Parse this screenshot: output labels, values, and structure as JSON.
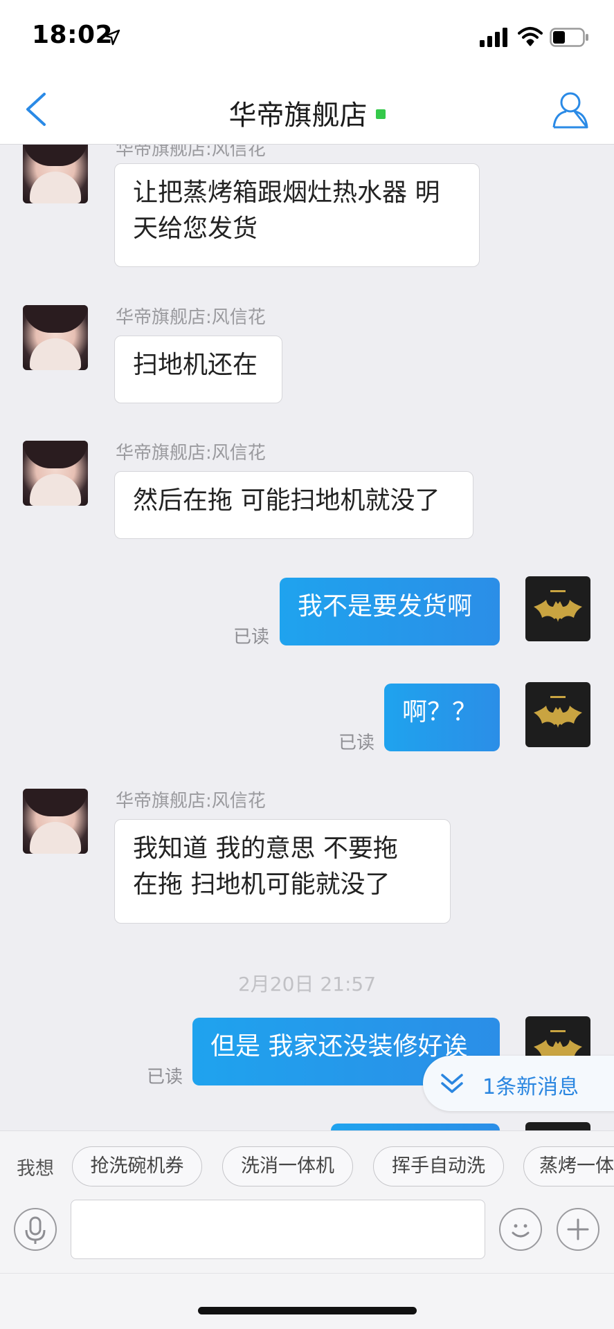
{
  "status_bar": {
    "time": "18:02"
  },
  "nav": {
    "title": "华帝旗舰店"
  },
  "messages": {
    "m1_sender": "华帝旗舰店:风信花",
    "m1_line1": "让把蒸烤箱跟烟灶热水器  明",
    "m1_line2": "天给您发货",
    "m2_sender": "华帝旗舰店:风信花",
    "m2_text": "扫地机还在",
    "m3_sender": "华帝旗舰店:风信花",
    "m3_text": "然后在拖 可能扫地机就没了",
    "m4_text": "我不是要发货啊",
    "m4_status": "已读",
    "m5_text": "啊？？",
    "m5_status": "已读",
    "m6_sender": "华帝旗舰店:风信花",
    "m6_line1": "我知道   我的意思  不要拖",
    "m6_line2": "在拖 扫地机可能就没了",
    "timestamp": "2月20日 21:57",
    "m7_text": "但是 我家还没装修好诶",
    "m7_status": "已读"
  },
  "new_message_banner": "1条新消息",
  "quick_replies": {
    "label": "我想",
    "chips": [
      "抢洗碗机券",
      "洗消一体机",
      "挥手自动洗",
      "蒸烤一体"
    ]
  },
  "input": {
    "placeholder": ""
  },
  "colors": {
    "accent": "#2b8ee7",
    "online": "#35c94a",
    "brand_gold": "#c9a441"
  }
}
